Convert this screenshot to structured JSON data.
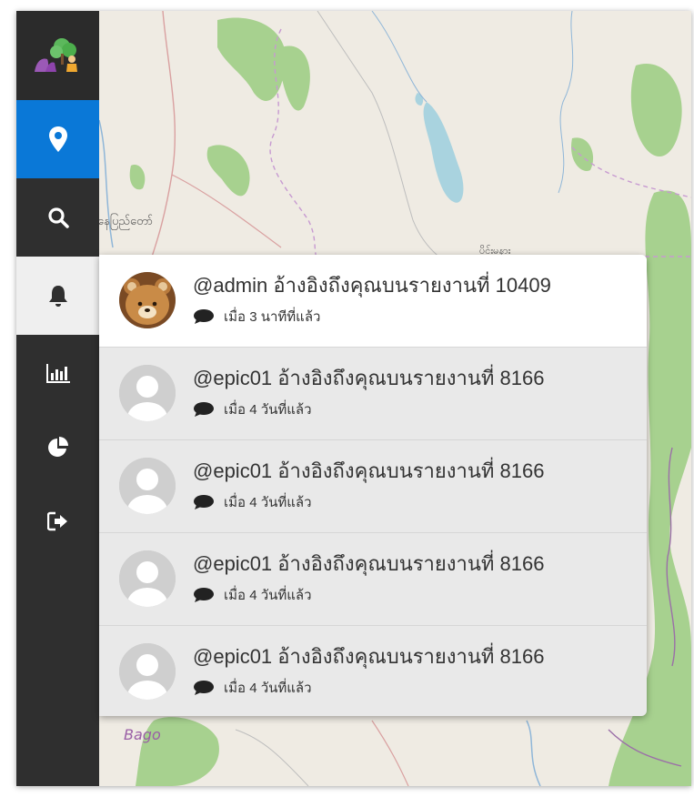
{
  "sidebar": {
    "items": [
      {
        "name": "logo",
        "icon": "app-logo-icon"
      },
      {
        "name": "map",
        "icon": "map-marker-icon",
        "active": true,
        "color": "#0a78d7"
      },
      {
        "name": "search",
        "icon": "search-icon"
      },
      {
        "name": "notifications",
        "icon": "bell-icon",
        "selected": true
      },
      {
        "name": "statistics",
        "icon": "bar-chart-icon"
      },
      {
        "name": "pie-chart",
        "icon": "pie-chart-icon"
      },
      {
        "name": "logout",
        "icon": "sign-out-icon"
      }
    ]
  },
  "map": {
    "labels": {
      "place1": "နေပြည်တော်",
      "place2": "ပိုင်းမနား",
      "bago": "Bago"
    }
  },
  "notifications": [
    {
      "message": "@admin อ้างอิงถึงคุณบนรายงานที่ 10409",
      "time": "เมื่อ 3 นาทีที่แล้ว",
      "avatar": "bear-avatar",
      "unread": true
    },
    {
      "message": "@epic01 อ้างอิงถึงคุณบนรายงานที่ 8166",
      "time": "เมื่อ 4 วันที่แล้ว",
      "avatar": "default-avatar",
      "unread": false
    },
    {
      "message": "@epic01 อ้างอิงถึงคุณบนรายงานที่ 8166",
      "time": "เมื่อ 4 วันที่แล้ว",
      "avatar": "default-avatar",
      "unread": false
    },
    {
      "message": "@epic01 อ้างอิงถึงคุณบนรายงานที่ 8166",
      "time": "เมื่อ 4 วันที่แล้ว",
      "avatar": "default-avatar",
      "unread": false
    },
    {
      "message": "@epic01 อ้างอิงถึงคุณบนรายงานที่ 8166",
      "time": "เมื่อ 4 วันที่แล้ว",
      "avatar": "default-avatar",
      "unread": false
    }
  ],
  "colors": {
    "sidebar_bg": "#2f2f2f",
    "accent": "#0a78d7",
    "unread_bg": "#ffffff",
    "read_bg": "#e9e9e9"
  }
}
